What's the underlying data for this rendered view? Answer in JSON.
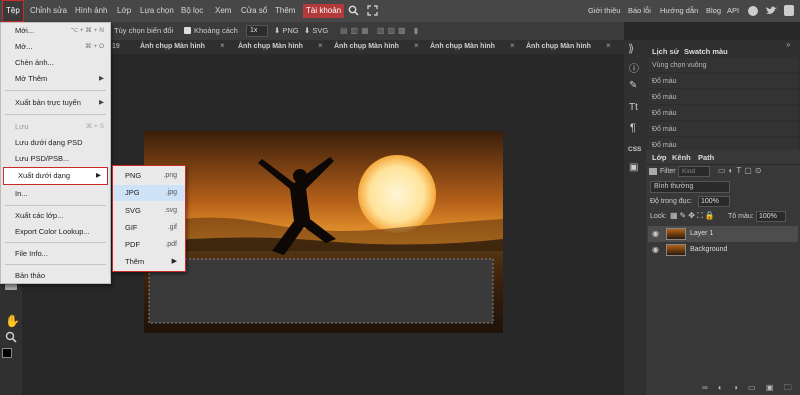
{
  "menubar": {
    "items": [
      "Tệp",
      "Chỉnh sửa",
      "Hình ảnh",
      "Lớp",
      "Lựa chọn",
      "Bộ lọc",
      "Xem",
      "Cửa sổ",
      "Thêm",
      "Tài khoản"
    ],
    "right_links": [
      "Giới thiệu",
      "Báo lỗi",
      "Hướng dẫn",
      "Blog",
      "API"
    ]
  },
  "optbar": {
    "transform_label": "Tùy chọn biến đổi",
    "spacing_label": "Khoảng cách",
    "scale_value": "1x",
    "png_label": "PNG",
    "svg_label": "SVG"
  },
  "tabs": [
    "Ảnh chụp Màn hình",
    "Ảnh chụp Màn hình",
    "Ảnh chụp Màn hình",
    "Ảnh chụp Màn hình",
    "Ảnh chụp Màn hình"
  ],
  "tab_fragment": "19",
  "file_menu": {
    "items": [
      {
        "label": "Mới...",
        "shortcut": "⌥ + ⌘ + N"
      },
      {
        "label": "Mở...",
        "shortcut": "⌘ + O"
      },
      {
        "label": "Chèn ảnh...",
        "shortcut": ""
      },
      {
        "label": "Mở Thêm",
        "shortcut": "▶"
      },
      {
        "label": "Xuất bản trực tuyến",
        "shortcut": "▶"
      },
      {
        "label": "Lưu",
        "shortcut": "⌘ + S"
      },
      {
        "label": "Lưu dưới dạng PSD",
        "shortcut": ""
      },
      {
        "label": "Lưu PSD/PSB...",
        "shortcut": ""
      },
      {
        "label": "Xuất dưới dạng",
        "shortcut": "▶"
      },
      {
        "label": "In...",
        "shortcut": ""
      },
      {
        "label": "Xuất các lớp...",
        "shortcut": ""
      },
      {
        "label": "Export Color Lookup...",
        "shortcut": ""
      },
      {
        "label": "File Info...",
        "shortcut": ""
      },
      {
        "label": "Bản thảo",
        "shortcut": ""
      }
    ]
  },
  "export_submenu": {
    "items": [
      {
        "label": "PNG",
        "ext": ".png"
      },
      {
        "label": "JPG",
        "ext": ".jpg"
      },
      {
        "label": "SVG",
        "ext": ".svg"
      },
      {
        "label": "GIF",
        "ext": ".gif"
      },
      {
        "label": "PDF",
        "ext": ".pdf"
      },
      {
        "label": "Thêm",
        "ext": "▶"
      }
    ]
  },
  "history_panel": {
    "tabs": [
      "Lịch sử",
      "Swatch màu"
    ],
    "items": [
      "Vùng chọn vuông",
      "Đổ màu",
      "Đổ màu",
      "Đổ màu",
      "Đổ màu",
      "Đổ màu"
    ]
  },
  "layers_panel": {
    "tabs": [
      "Lớp",
      "Kênh",
      "Path"
    ],
    "filter_label": "Filter",
    "kind_value": "Kind",
    "blend_mode": "Bình thường",
    "opacity_label": "Độ trong đục:",
    "opacity_value": "100%",
    "lock_label": "Lock:",
    "fill_label": "Tô màu:",
    "fill_value": "100%",
    "layers": [
      "Layer 1",
      "Background"
    ]
  },
  "right_icon_bar": {
    "css_label": "CSS"
  },
  "colors": {
    "menubar_bg": "#474747",
    "menu_bg": "#e9e9e9",
    "highlight_red": "#cc2a2a",
    "selected_row": "#cfe3f8",
    "account_bg": "#b33a3a"
  }
}
